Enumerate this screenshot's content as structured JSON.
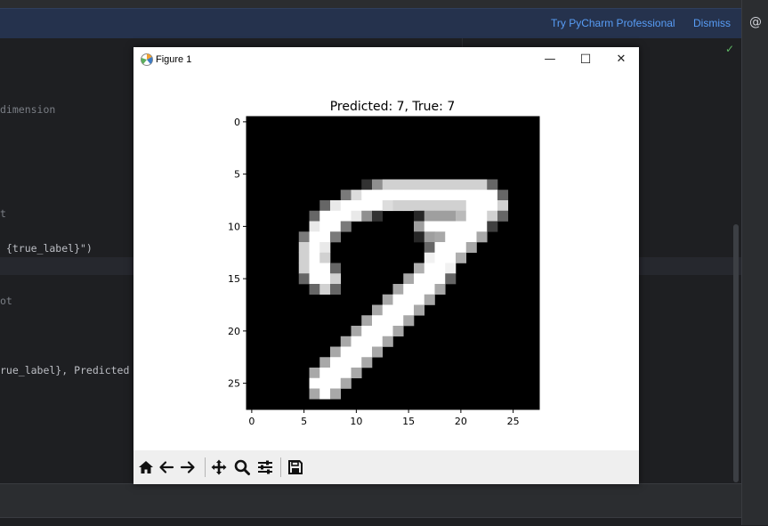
{
  "banner": {
    "try_label": "Try PyCharm Professional",
    "dismiss_label": "Dismiss"
  },
  "code_lines": [
    "dimension",
    "t",
    " {true_label}\")",
    "ot",
    "rue_label}, Predicted"
  ],
  "figure": {
    "title": "Figure 1",
    "controls": {
      "minimize": "—",
      "maximize": "☐",
      "close": "✕"
    },
    "plot_title": "Predicted: 7, True: 7",
    "x_ticks": [
      "0",
      "5",
      "10",
      "15",
      "20",
      "25"
    ],
    "y_ticks": [
      "0",
      "5",
      "10",
      "15",
      "20",
      "25"
    ]
  },
  "toolbar_icons": [
    "home-icon",
    "back-arrow-icon",
    "forward-arrow-icon",
    "pan-icon",
    "zoom-icon",
    "configure-subplots-icon",
    "save-icon"
  ],
  "chart_data": {
    "type": "heatmap",
    "title": "Predicted: 7, True: 7",
    "xlabel": "",
    "ylabel": "",
    "xlim": [
      -0.5,
      27.5
    ],
    "ylim": [
      27.5,
      -0.5
    ],
    "colormap": "gray",
    "strokes": [
      {
        "points": [
          [
            8,
            9
          ],
          [
            10,
            8
          ],
          [
            13,
            7
          ],
          [
            16,
            7
          ],
          [
            19,
            7
          ],
          [
            22,
            7
          ],
          [
            23,
            8
          ]
        ],
        "width": 1.0
      },
      {
        "points": [
          [
            22,
            8
          ],
          [
            21,
            10
          ],
          [
            19,
            12
          ],
          [
            17,
            15
          ],
          [
            15,
            17
          ],
          [
            13,
            19
          ],
          [
            11,
            21
          ],
          [
            9,
            23
          ],
          [
            7,
            25
          ]
        ],
        "width": 1.25
      },
      {
        "points": [
          [
            8,
            9
          ],
          [
            7,
            10
          ],
          [
            6,
            12
          ],
          [
            6,
            14
          ],
          [
            7,
            15
          ]
        ],
        "width": 1.0
      },
      {
        "points": [
          [
            17,
            10
          ],
          [
            19,
            10
          ]
        ],
        "width": 0.8
      }
    ]
  }
}
